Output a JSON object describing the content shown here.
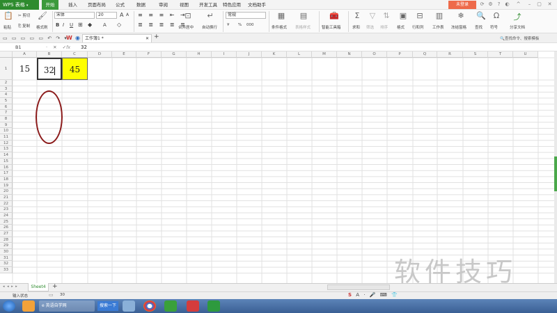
{
  "app": {
    "name": "WPS 表格",
    "brand_color": "#2e8b2e",
    "active_tab_color": "#3c9a3c",
    "login_label": "未登录",
    "login_color": "#ee6a4a"
  },
  "menu": [
    "开始",
    "插入",
    "页面布局",
    "公式",
    "数据",
    "审阅",
    "视图",
    "开发工具",
    "特色应用",
    "文档助手"
  ],
  "ribbon": {
    "paste": "粘贴",
    "cut": "剪切",
    "copy": "复制",
    "format_painter": "格式刷",
    "font_name": "宋体",
    "font_size": "20",
    "font_size_up": "A",
    "font_size_down": "A",
    "bold": "B",
    "italic": "I",
    "underline": "U",
    "merge_center": "合并居中",
    "wrap_text": "自动换行",
    "number_format": "常规",
    "currency": "¥",
    "percent": "%",
    "thousands": "000",
    "conditional_format": "条件格式",
    "table_style": "表格样式",
    "smart_toolbox": "智能工具箱",
    "sum": "求和",
    "filter": "筛选",
    "sort": "排序",
    "format": "格式",
    "row_col": "行和列",
    "worksheet": "工作表",
    "freeze": "冻结窗格",
    "find": "查找",
    "symbol": "符号",
    "share": "分享文档"
  },
  "quickbar": {
    "doc_tab": "工作簿1 *",
    "search_placeholder": "查找命令、搜索模板"
  },
  "formula": {
    "cell_ref": "B1",
    "fx": "fx",
    "value": "32"
  },
  "columns": [
    "A",
    "B",
    "C",
    "D",
    "E",
    "F",
    "G",
    "H",
    "I",
    "J",
    "K",
    "L",
    "M",
    "N",
    "O",
    "P",
    "Q",
    "R",
    "S",
    "T",
    "U"
  ],
  "rows": [
    "1",
    "2",
    "3",
    "4",
    "5",
    "6",
    "7",
    "8",
    "9",
    "10",
    "11",
    "12",
    "13",
    "14",
    "15",
    "16",
    "17",
    "18",
    "19",
    "20",
    "21",
    "22",
    "23",
    "24",
    "25",
    "26",
    "27",
    "28",
    "29",
    "30",
    "31",
    "32",
    "33"
  ],
  "cells": {
    "A1": "15",
    "B1": "32",
    "C1": "45",
    "C1_fill": "#ffff00"
  },
  "annotation_color": "#8b1a1a",
  "sheet_tab": "Sheet4",
  "status": {
    "mode": "输入状态",
    "value": "30"
  },
  "taskbar": {
    "browser_tab": "英语自学网",
    "search_button": "搜索一下"
  },
  "watermark": "软件技巧",
  "icons": {
    "paste": "clipboard-icon",
    "cut": "scissors-icon",
    "copy": "copy-icon",
    "painter": "brush-icon",
    "sum": "sigma-icon",
    "find": "magnifier-icon",
    "symbol": "omega-icon",
    "share": "share-icon"
  }
}
